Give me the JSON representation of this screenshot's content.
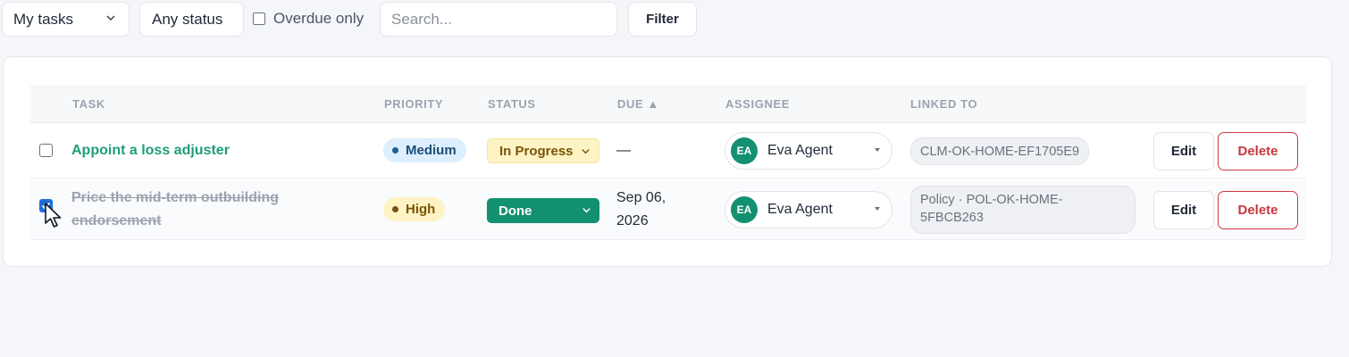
{
  "toolbar": {
    "scope_select": "My tasks",
    "status_select": "Any status",
    "overdue_label": "Overdue only",
    "search_placeholder": "Search...",
    "filter_label": "Filter"
  },
  "table": {
    "columns": [
      "TASK",
      "PRIORITY",
      "STATUS",
      "DUE ▲",
      "ASSIGNEE",
      "LINKED TO"
    ],
    "rows": [
      {
        "checked": false,
        "task": "Appoint a loss adjuster",
        "priority": "Medium",
        "status": "In Progress",
        "due": "—",
        "assignee_initials": "EA",
        "assignee": "Eva Agent",
        "linked_to": "CLM-OK-HOME-EF1705E9",
        "edit": "Edit",
        "delete": "Delete"
      },
      {
        "checked": true,
        "task": "Price the mid-term outbuilding endorsement",
        "priority": "High",
        "status": "Done",
        "due": "Sep 06, 2026",
        "assignee_initials": "EA",
        "assignee": "Eva Agent",
        "linked_to": "Policy · POL-OK-HOME-5FBCB263",
        "edit": "Edit",
        "delete": "Delete"
      }
    ]
  },
  "colors": {
    "accent": "#13906f",
    "task_link": "#1f9d7a",
    "danger": "#c8363c",
    "priority_medium_bg": "#ddeefe",
    "priority_high_bg": "#fdf3c4",
    "checkbox_checked": "#1e6fd9"
  },
  "icons": {
    "select_caret": "chevron-down-icon",
    "assignee_caret": "caret-down-icon",
    "pointer": "mouse-cursor-icon"
  }
}
